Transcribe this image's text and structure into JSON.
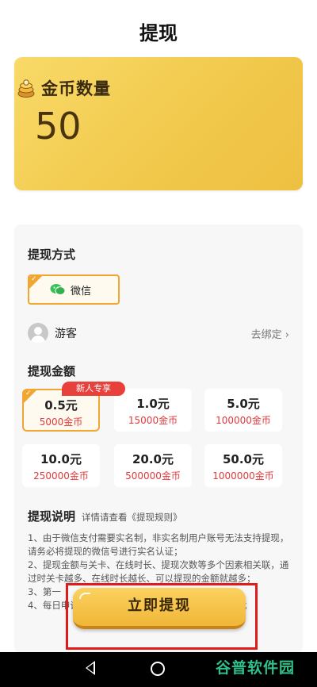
{
  "header": {
    "title": "提现"
  },
  "coin_card": {
    "label": "金币数量",
    "value": "50"
  },
  "method": {
    "title": "提现方式",
    "option_label": "微信",
    "user_name": "游客",
    "bind_label": "去绑定"
  },
  "amount": {
    "title": "提现金额",
    "badge": "新人专享",
    "options": [
      {
        "yuan": "0.5元",
        "coins": "5000金币"
      },
      {
        "yuan": "1.0元",
        "coins": "15000金币"
      },
      {
        "yuan": "5.0元",
        "coins": "100000金币"
      },
      {
        "yuan": "10.0元",
        "coins": "250000金币"
      },
      {
        "yuan": "20.0元",
        "coins": "500000金币"
      },
      {
        "yuan": "50.0元",
        "coins": "1000000金币"
      }
    ],
    "selected_index": 0
  },
  "notes": {
    "title": "提现说明",
    "hint": "详情请查看",
    "rules_link": "《提现规则》",
    "lines": [
      "1、由于微信支付需要实名制，非实名制用户账号无法支持提现，请务必将提现的微信号进行实名认证；",
      "2、提现金额与关卡、在线时长、提现次数等多个因素相关联，通过时关卡越多、在线时长越长、可以提现的金额就越多；",
      "3、第一",
      "4、每日申请提现一次，若当日额度已满，请次日申请；"
    ]
  },
  "cta": {
    "label": "立即提现"
  },
  "watermark": "谷普软件园",
  "colors": {
    "accent": "#f0a630",
    "coin_red": "#e0393a",
    "link_blue": "#2a5ad8",
    "highlight_red": "#e11a1a"
  }
}
